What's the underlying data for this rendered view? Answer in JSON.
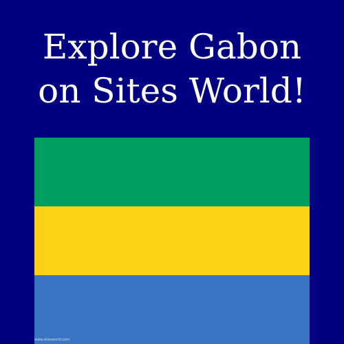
{
  "headline": {
    "line1": "Explore Gabon",
    "line2": "on Sites World!"
  },
  "flag": {
    "country": "Gabon",
    "stripes": [
      {
        "name": "green",
        "color": "#009E60"
      },
      {
        "name": "yellow",
        "color": "#FCD116"
      },
      {
        "name": "blue",
        "color": "#3A75C4"
      }
    ]
  },
  "watermark": "www.sitesworld.com",
  "colors": {
    "background": "#000080",
    "text": "#ffffff"
  }
}
